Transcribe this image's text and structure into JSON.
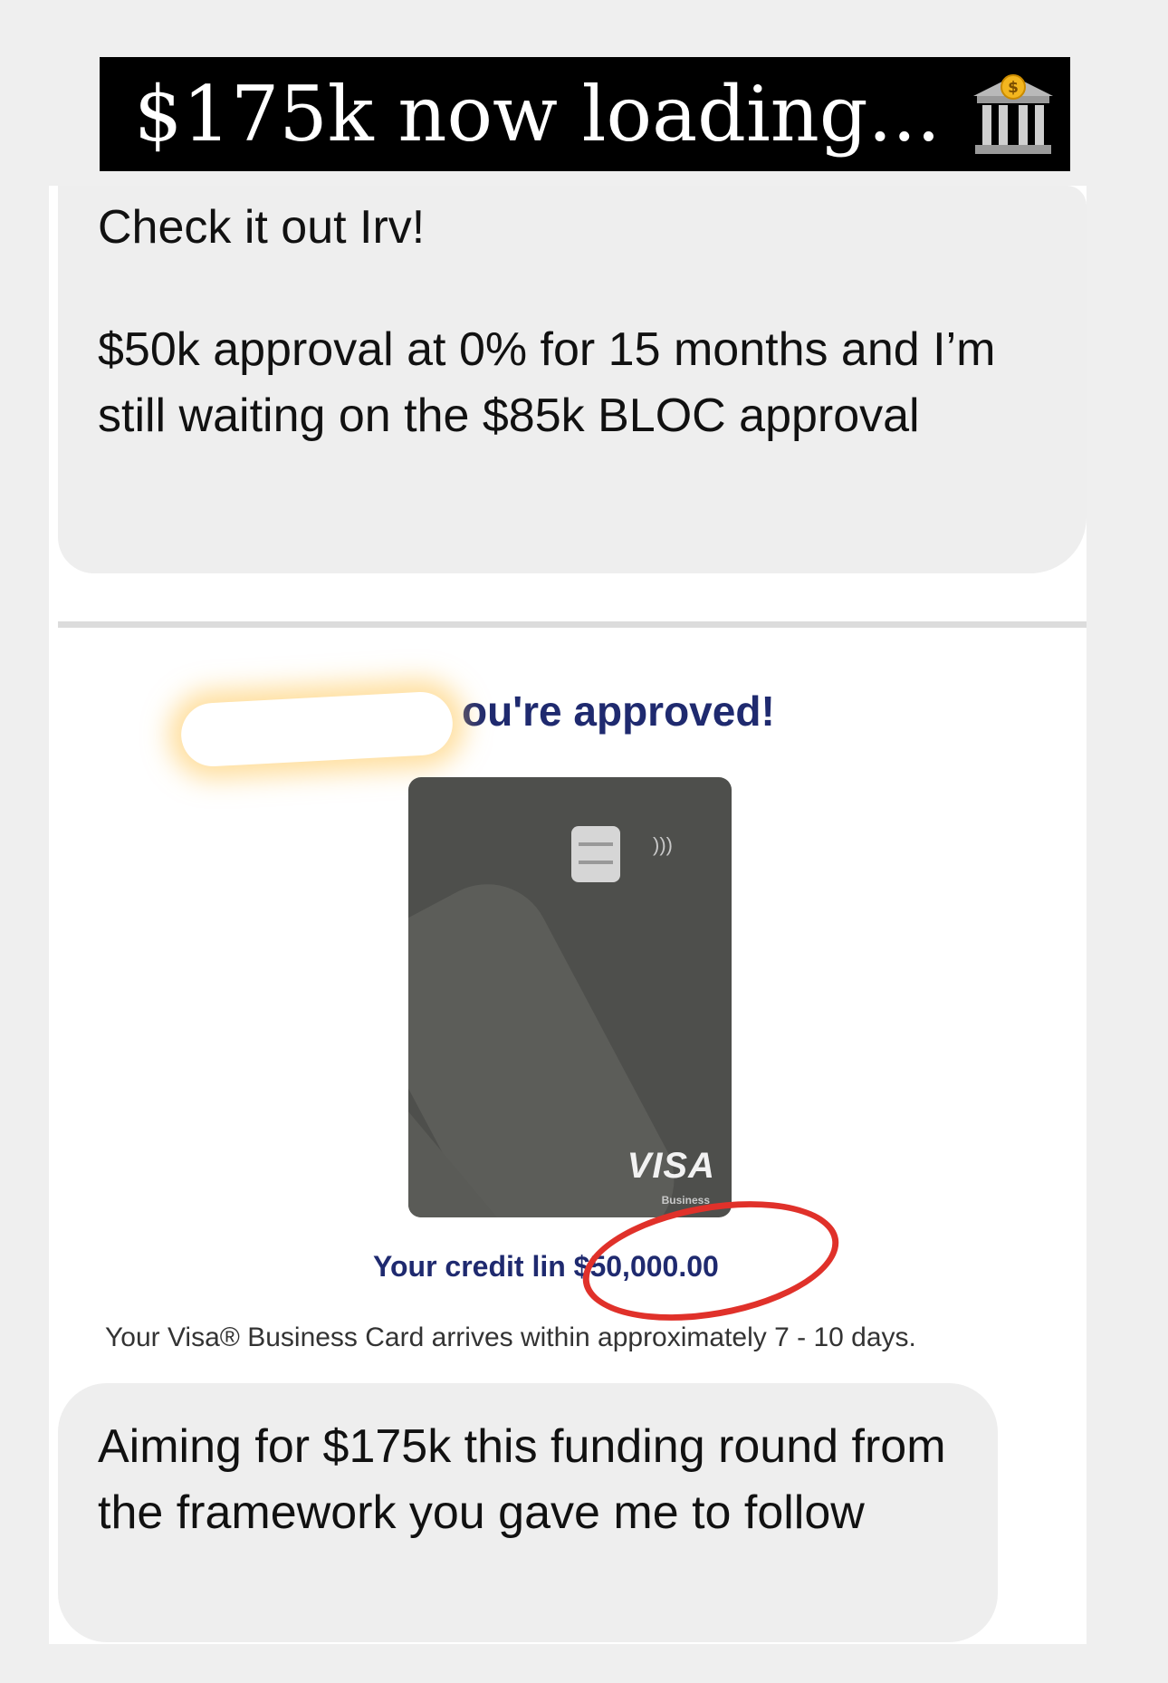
{
  "headline": {
    "text": "$175k now loading...",
    "icon": "bank-icon"
  },
  "message_1": {
    "line_1": "Check it out Irv!",
    "line_2": "$50k approval at 0% for 15 months and I’m still waiting on the $85k BLOC approval"
  },
  "approval": {
    "title": "ou're approved!",
    "card": {
      "brand": "VISA",
      "tier": "Business"
    },
    "credit_line_label": "Your credit lin",
    "credit_line_value": "$50,000.00",
    "arrival_note": "Your Visa® Business Card arrives within approximately 7 - 10 days."
  },
  "message_2": {
    "text": "Aiming for $175k this funding round from the framework you gave me to follow"
  },
  "colors": {
    "headline_bg": "#000000",
    "bubble_bg": "#eeeeee",
    "approval_text": "#1f2a6f",
    "card_bg": "#4e4f4c",
    "circle_annotation": "#e0312a"
  }
}
